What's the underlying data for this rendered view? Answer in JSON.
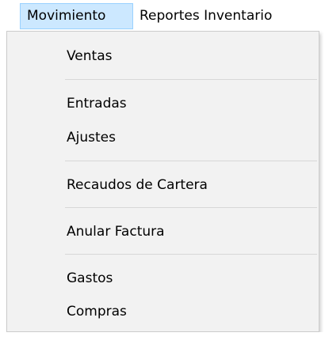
{
  "menubar": {
    "items": [
      {
        "label": "Movimiento",
        "active": true
      },
      {
        "label": "Reportes Inventario",
        "active": false
      }
    ]
  },
  "dropdown": {
    "groups": [
      [
        "Ventas"
      ],
      [
        "Entradas",
        "Ajustes"
      ],
      [
        "Recaudos de Cartera"
      ],
      [
        "Anular Factura"
      ],
      [
        "Gastos",
        "Compras"
      ]
    ]
  },
  "colors": {
    "menubar_active_bg": "#cce8ff",
    "menubar_active_border": "#99d1ff",
    "dropdown_bg": "#f2f2f2",
    "separator": "#d7d7d7"
  }
}
